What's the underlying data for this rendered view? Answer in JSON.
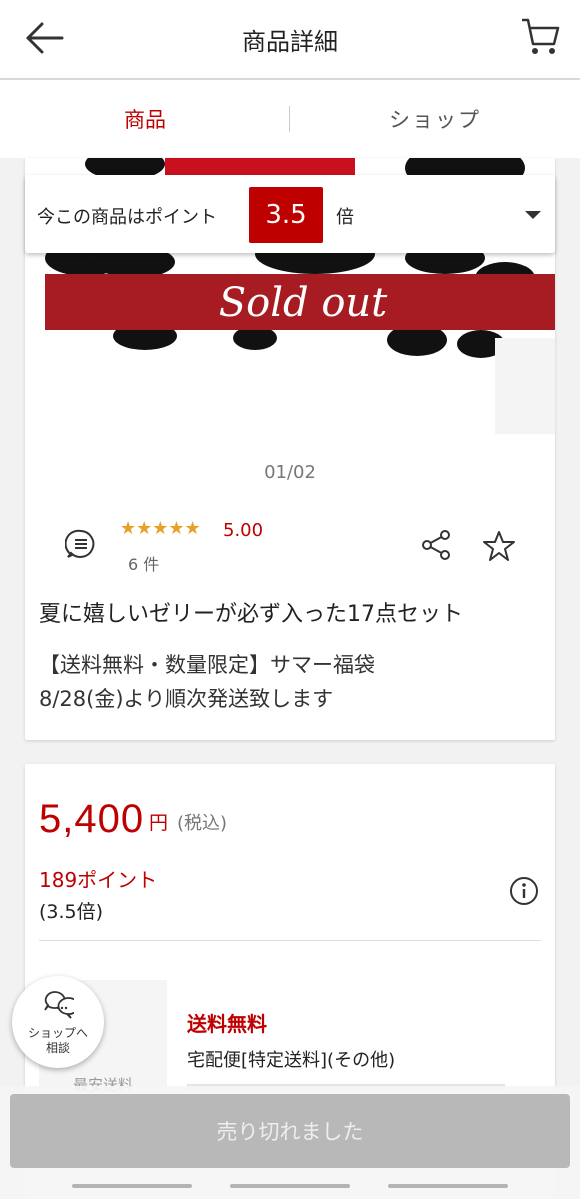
{
  "header": {
    "title": "商品詳細",
    "back_icon": "arrow-left-icon",
    "cart_icon": "cart-icon"
  },
  "tabs": [
    {
      "label": "商品",
      "active": true
    },
    {
      "label": "ショップ",
      "active": false
    }
  ],
  "points_banner": {
    "prefix": "今この商品はポイント",
    "multiplier": "3.5",
    "suffix": "倍"
  },
  "image": {
    "sold_out_text": "Sold out",
    "pagination": "01/02"
  },
  "review": {
    "stars": "★★★★★",
    "rating": "5.00",
    "count": "6 件"
  },
  "product": {
    "title": "夏に嬉しいゼリーが必ず入った17点セット",
    "desc_line1": "【送料無料・数量限定】サマー福袋",
    "desc_line2": "8/28(金)より順次発送致します"
  },
  "price": {
    "amount": "5,400",
    "unit": "円",
    "tax": "(税込)",
    "points": "189ポイント",
    "points_rate": "(3.5倍)"
  },
  "shipping": {
    "thumb_label": "最安送料",
    "free_label": "送料無料",
    "method": "宅配便[特定送料](その他)"
  },
  "consult": {
    "line1": "ショップへ",
    "line2": "相談"
  },
  "bottom": {
    "button_label": "売り切れました"
  },
  "colors": {
    "accent": "#bf0000",
    "star": "#e8a028",
    "soldout_bar": "#a71c22"
  }
}
